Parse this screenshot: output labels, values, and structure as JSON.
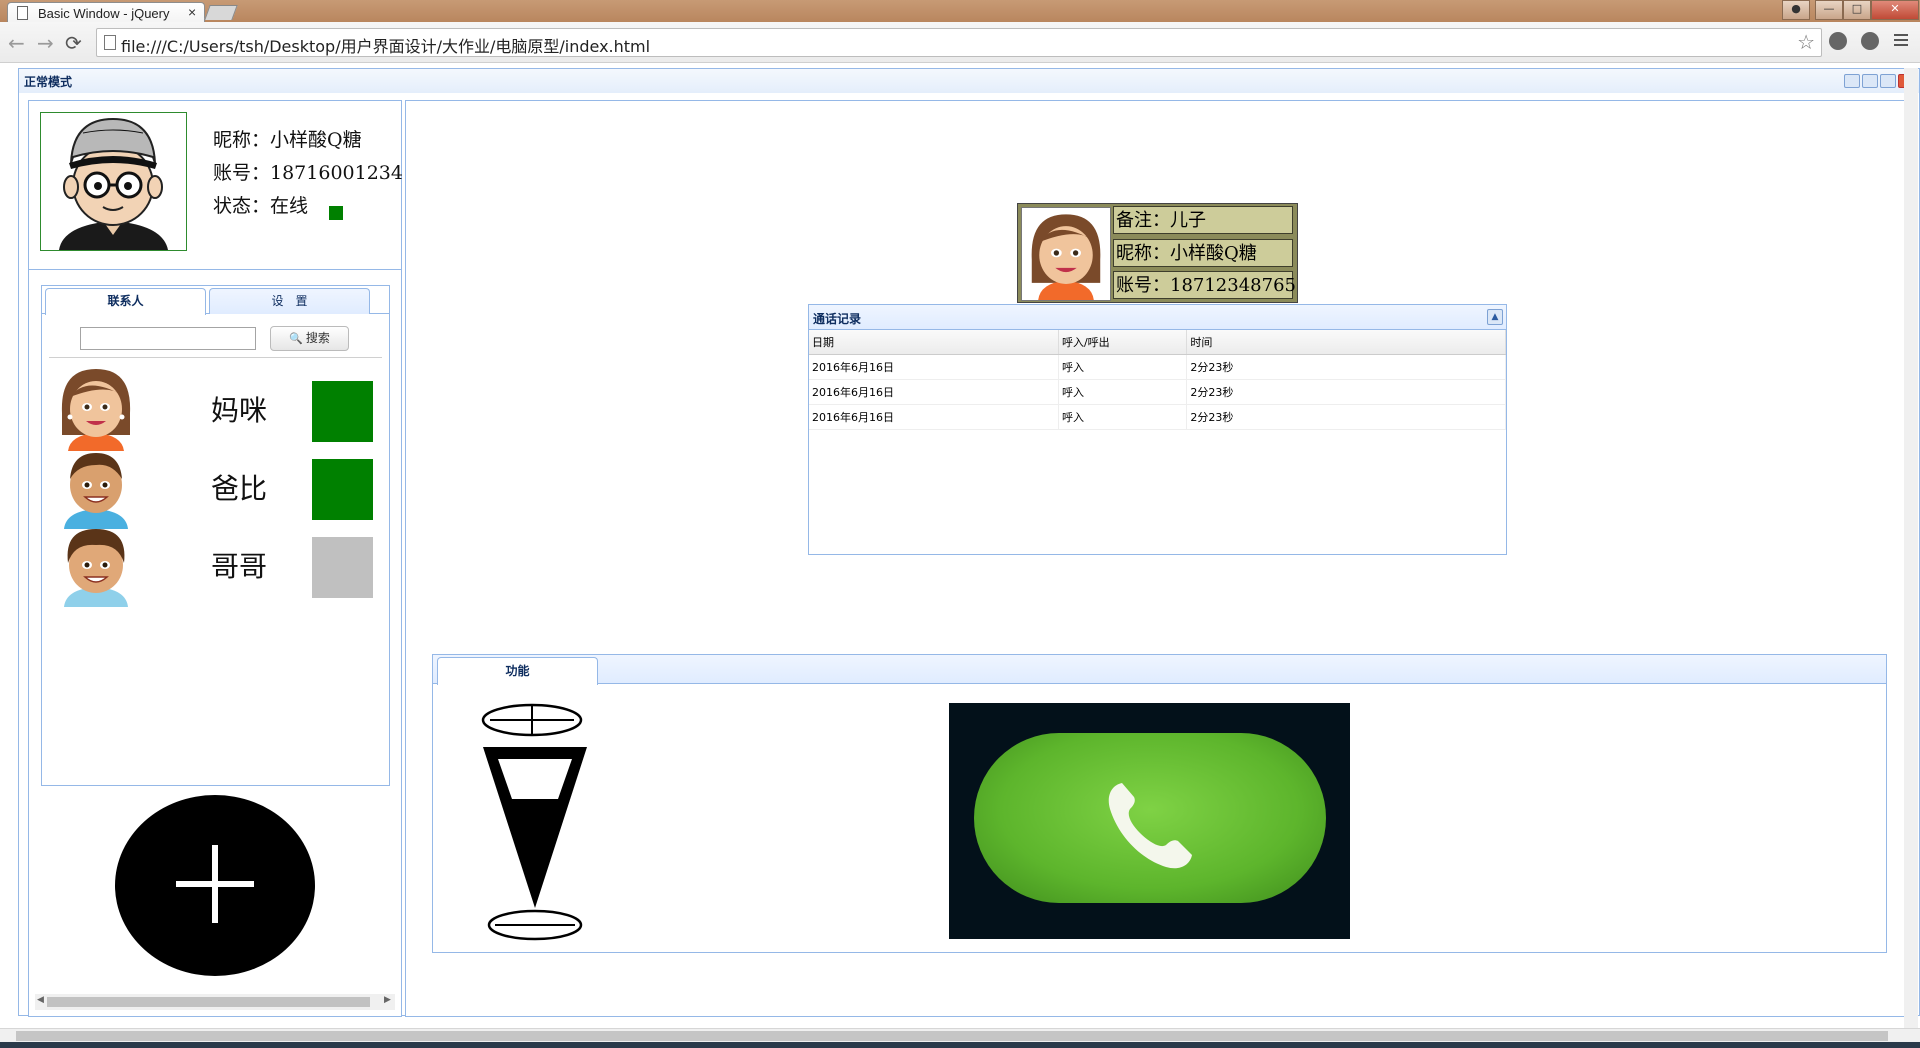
{
  "browser": {
    "tab_title": "Basic Window - jQuery",
    "tab_close": "×",
    "url": "file:///C:/Users/tsh/Desktop/用户界面设计/大作业/电脑原型/index.html",
    "back_glyph": "←",
    "forward_glyph": "→",
    "reload_glyph": "⟳",
    "star_glyph": "☆"
  },
  "app": {
    "title": "正常模式"
  },
  "profile": {
    "nickname_line": "昵称：小样酸Q糖",
    "account_line": "账号：18716001234",
    "status_line": "状态：在线",
    "status_color": "#008000"
  },
  "left_tabs": {
    "contacts_tab": "联系人",
    "settings_tab": "设　置",
    "search_placeholder": "",
    "search_button": "搜索"
  },
  "contacts": [
    {
      "name": "妈咪",
      "status_color": "#008000",
      "online": true
    },
    {
      "name": "爸比",
      "status_color": "#008000",
      "online": true
    },
    {
      "name": "哥哥",
      "status_color": "#c0c0c0",
      "online": false
    }
  ],
  "contact_card": {
    "remark_line": "备注：儿子",
    "nickname_line": "昵称：小样酸Q糖",
    "account_line": "账号：18712348765"
  },
  "call_log": {
    "title": "通话记录",
    "columns": [
      "日期",
      "呼入/呼出",
      "时间"
    ],
    "rows": [
      [
        "2016年6月16日",
        "呼入",
        "2分23秒"
      ],
      [
        "2016年6月16日",
        "呼入",
        "2分23秒"
      ],
      [
        "2016年6月16日",
        "呼入",
        "2分23秒"
      ]
    ]
  },
  "function_panel": {
    "tab_label": "功能"
  },
  "icons": {
    "add": "plus-icon",
    "call": "phone-icon",
    "volume": "volume-icon",
    "search": "magnifier-icon"
  }
}
